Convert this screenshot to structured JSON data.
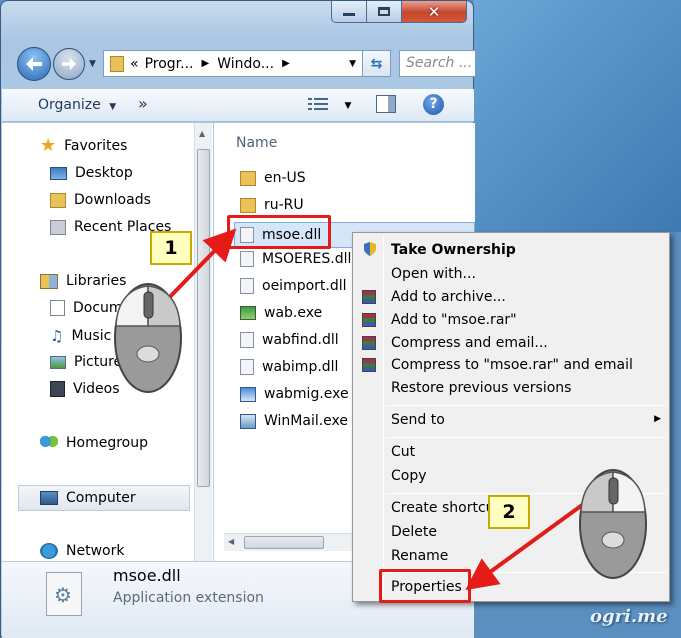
{
  "window": {
    "address_segments": [
      "«",
      "Progr...",
      "Windo...",
      ""
    ],
    "search_placeholder": "Search ..."
  },
  "toolbar": {
    "organize_label": "Organize",
    "more_label": "»"
  },
  "nav_pane": {
    "favorites": "Favorites",
    "desktop": "Desktop",
    "downloads": "Downloads",
    "recent_places": "Recent Places",
    "libraries": "Libraries",
    "documents": "Docum",
    "music": "Music",
    "pictures": "Picture",
    "videos": "Videos",
    "homegroup": "Homegroup",
    "computer": "Computer",
    "network": "Network"
  },
  "files": {
    "column_name": "Name",
    "items": [
      "en-US",
      "ru-RU",
      "msoe.dll",
      "MSOERES.dll",
      "oeimport.dll",
      "wab.exe",
      "wabfind.dll",
      "wabimp.dll",
      "wabmig.exe",
      "WinMail.exe"
    ]
  },
  "details": {
    "name": "msoe.dll",
    "type": "Application extension"
  },
  "context_menu": {
    "take_ownership": "Take Ownership",
    "open_with": "Open with...",
    "add_to_archive": "Add to archive...",
    "add_to_rar": "Add to \"msoe.rar\"",
    "compress_email": "Compress and email...",
    "compress_rar_email": "Compress to \"msoe.rar\" and email",
    "restore_versions": "Restore previous versions",
    "send_to": "Send to",
    "cut": "Cut",
    "copy": "Copy",
    "create_shortcut": "Create shortcut",
    "delete": "Delete",
    "rename": "Rename",
    "properties": "Properties"
  },
  "callouts": {
    "step1": "1",
    "step2": "2"
  },
  "watermark": "ogri.me",
  "colors": {
    "accent": "#e41b17",
    "callout_fill": "#ffffc0",
    "title_bar": "#a9c6e4"
  }
}
